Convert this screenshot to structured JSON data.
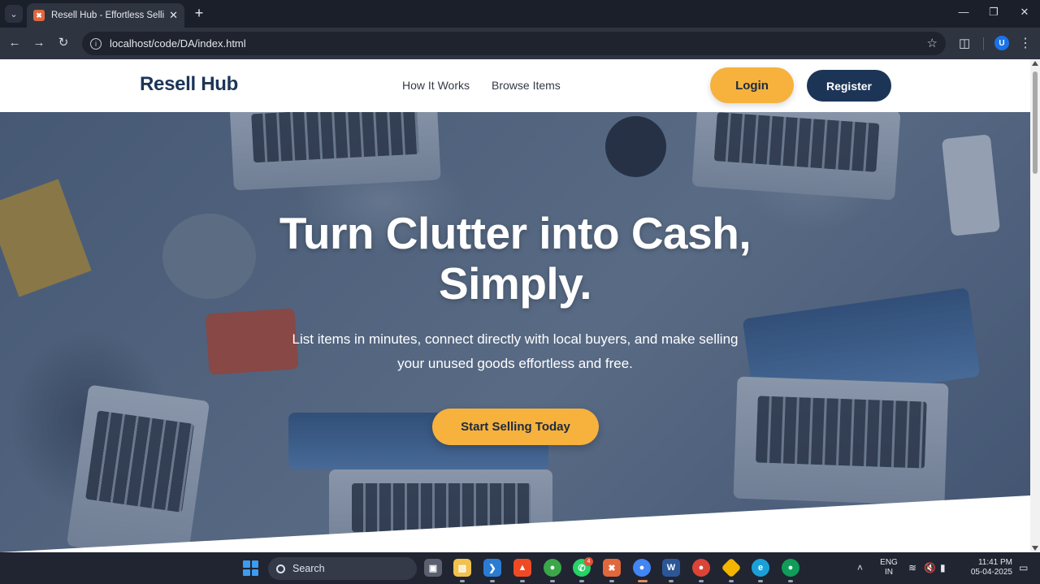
{
  "browser": {
    "tab": {
      "title": "Resell Hub - Effortless Selling, D",
      "favicon": "xampp-icon"
    },
    "new_tab_icon": "+",
    "url": "localhost/code/DA/index.html",
    "avatar_letter": "U"
  },
  "site": {
    "brand": "Resell Hub",
    "nav": [
      {
        "label": "How It Works"
      },
      {
        "label": "Browse Items"
      }
    ],
    "login_label": "Login",
    "register_label": "Register",
    "hero": {
      "title_line1": "Turn Clutter into Cash,",
      "title_line2": "Simply.",
      "subtitle_line1": "List items in minutes, connect directly with local buyers, and make selling",
      "subtitle_line2": "your unused goods effortless and free.",
      "cta_label": "Start Selling Today"
    }
  },
  "colors": {
    "brand_navy": "#1c3557",
    "accent_orange": "#f6b23d",
    "hero_overlay": "#1e375f"
  },
  "taskbar": {
    "search_label": "Search",
    "apps": [
      {
        "name": "task-view-icon",
        "badge": ""
      },
      {
        "name": "file-explorer-icon",
        "badge": ""
      },
      {
        "name": "vscode-icon",
        "badge": ""
      },
      {
        "name": "brave-icon",
        "badge": ""
      },
      {
        "name": "chrome-profile-icon",
        "badge": ""
      },
      {
        "name": "whatsapp-icon",
        "badge": "4"
      },
      {
        "name": "xampp-icon",
        "badge": ""
      },
      {
        "name": "chrome-icon",
        "badge": ""
      },
      {
        "name": "word-icon",
        "badge": ""
      },
      {
        "name": "chrome-k-icon",
        "badge": ""
      },
      {
        "name": "git-icon",
        "badge": ""
      },
      {
        "name": "edge-icon",
        "badge": ""
      },
      {
        "name": "chrome-alt-icon",
        "badge": ""
      }
    ],
    "lang_top": "ENG",
    "lang_bottom": "IN",
    "time": "11:41 PM",
    "date": "05-04-2025"
  }
}
